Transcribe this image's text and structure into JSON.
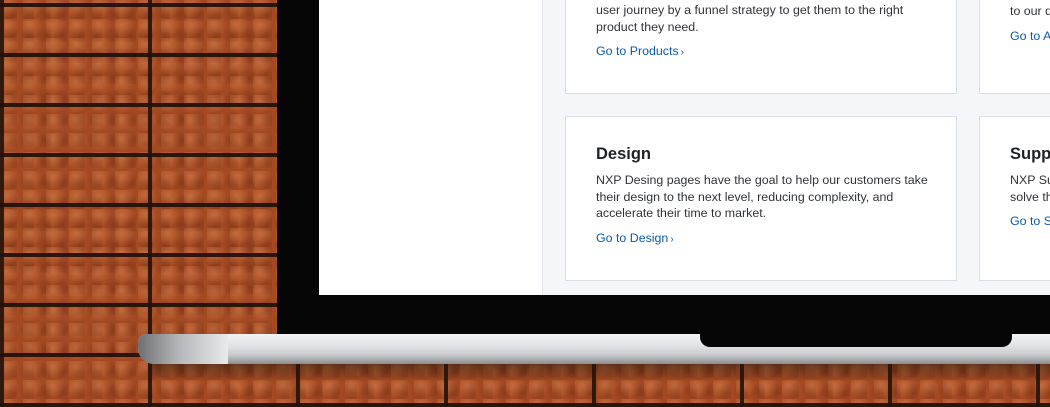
{
  "cards": {
    "products": {
      "text": "user journey by a funnel strategy to get them to the right product they need.",
      "link": "Go to Products"
    },
    "top_right": {
      "text": "to our d",
      "link": "Go to A"
    },
    "design": {
      "title": "Design",
      "text": "NXP Desing pages have the goal to help our customers take their design to the next level, reducing complexity, and accelerate their time to market.",
      "link": "Go to Design"
    },
    "support": {
      "title": "Suppo",
      "text": "NXP Su solve th",
      "link": "Go to S"
    }
  },
  "icons": {
    "link_chevron": "›"
  },
  "colors": {
    "link": "#0a5aa8",
    "card_border": "#d9dee4",
    "screen_bg": "#f4f6f9",
    "brick": "#a44a23"
  }
}
